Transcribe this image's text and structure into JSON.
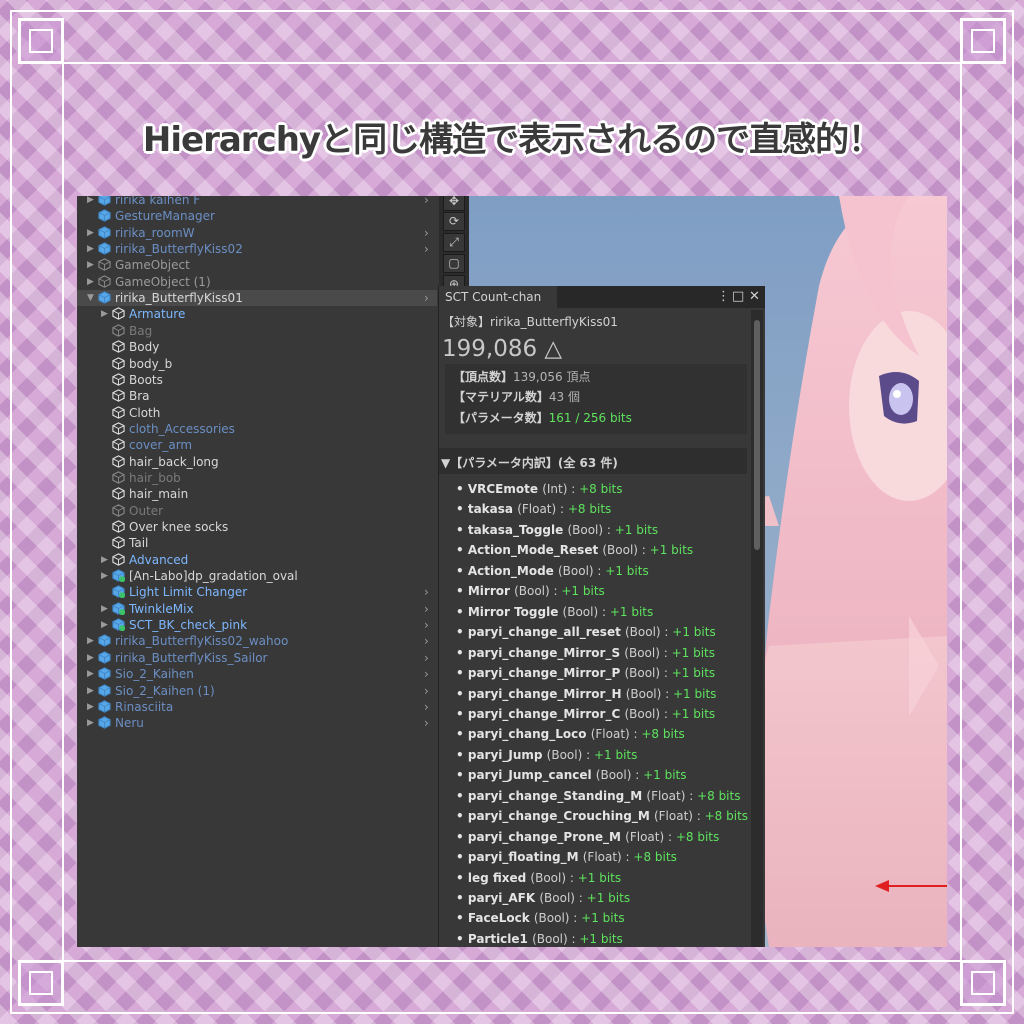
{
  "title": "Hierarchyと同じ構造で表示されるので直感的！",
  "colors": {
    "frame_purple": "#d7a9d7",
    "unity_bg": "#383838",
    "green_value": "#5ee35e",
    "blue_text": "#7db7ff"
  },
  "hierarchy": [
    {
      "label": "ririka kaihen F",
      "depth": 0,
      "arrow": "right",
      "icon": "prefab",
      "style": "dim",
      "chev": true
    },
    {
      "label": "GestureManager",
      "depth": 0,
      "arrow": "",
      "icon": "prefab",
      "style": "dim",
      "chev": false
    },
    {
      "label": "ririka_roomW",
      "depth": 0,
      "arrow": "right",
      "icon": "prefab",
      "style": "dim",
      "chev": true
    },
    {
      "label": "ririka_ButterflyKiss02",
      "depth": 0,
      "arrow": "right",
      "icon": "prefab",
      "style": "dim",
      "chev": true
    },
    {
      "label": "GameObject",
      "depth": 0,
      "arrow": "right",
      "icon": "cube",
      "style": "gray",
      "chev": false
    },
    {
      "label": "GameObject (1)",
      "depth": 0,
      "arrow": "right",
      "icon": "cube",
      "style": "gray",
      "chev": false
    },
    {
      "label": "ririka_ButterflyKiss01",
      "depth": 0,
      "arrow": "down",
      "icon": "prefab",
      "style": "white",
      "chev": true,
      "selected": true
    },
    {
      "label": "Armature",
      "depth": 1,
      "arrow": "right",
      "icon": "cube",
      "style": "blue",
      "chev": false
    },
    {
      "label": "Bag",
      "depth": 1,
      "arrow": "",
      "icon": "cube",
      "style": "dimgray",
      "chev": false
    },
    {
      "label": "Body",
      "depth": 1,
      "arrow": "",
      "icon": "cube",
      "style": "white",
      "chev": false
    },
    {
      "label": "body_b",
      "depth": 1,
      "arrow": "",
      "icon": "cube",
      "style": "white",
      "chev": false
    },
    {
      "label": "Boots",
      "depth": 1,
      "arrow": "",
      "icon": "cube",
      "style": "white",
      "chev": false
    },
    {
      "label": "Bra",
      "depth": 1,
      "arrow": "",
      "icon": "cube",
      "style": "white",
      "chev": false
    },
    {
      "label": "Cloth",
      "depth": 1,
      "arrow": "",
      "icon": "cube",
      "style": "white",
      "chev": false
    },
    {
      "label": "cloth_Accessories",
      "depth": 1,
      "arrow": "",
      "icon": "cube",
      "style": "dim",
      "chev": false
    },
    {
      "label": "cover_arm",
      "depth": 1,
      "arrow": "",
      "icon": "cube",
      "style": "dim",
      "chev": false
    },
    {
      "label": "hair_back_long",
      "depth": 1,
      "arrow": "",
      "icon": "cube",
      "style": "white",
      "chev": false
    },
    {
      "label": "hair_bob",
      "depth": 1,
      "arrow": "",
      "icon": "cube",
      "style": "dimgray",
      "chev": false
    },
    {
      "label": "hair_main",
      "depth": 1,
      "arrow": "",
      "icon": "cube",
      "style": "white",
      "chev": false
    },
    {
      "label": "Outer",
      "depth": 1,
      "arrow": "",
      "icon": "cube",
      "style": "dimgray",
      "chev": false
    },
    {
      "label": "Over knee socks",
      "depth": 1,
      "arrow": "",
      "icon": "cube",
      "style": "white",
      "chev": false
    },
    {
      "label": "Tail",
      "depth": 1,
      "arrow": "",
      "icon": "cube",
      "style": "white",
      "chev": false
    },
    {
      "label": "Advanced",
      "depth": 1,
      "arrow": "right",
      "icon": "cube",
      "style": "blue",
      "chev": false
    },
    {
      "label": "[An-Labo]dp_gradation_oval",
      "depth": 1,
      "arrow": "right",
      "icon": "prefab-green",
      "style": "white",
      "chev": false
    },
    {
      "label": "Light Limit Changer",
      "depth": 1,
      "arrow": "",
      "icon": "prefab-green",
      "style": "blue",
      "chev": true
    },
    {
      "label": "TwinkleMix",
      "depth": 1,
      "arrow": "right",
      "icon": "prefab-green",
      "style": "blue",
      "chev": true
    },
    {
      "label": "SCT_BK_check_pink",
      "depth": 1,
      "arrow": "right",
      "icon": "prefab-green",
      "style": "blue",
      "chev": true
    },
    {
      "label": "ririka_ButterflyKiss02_wahoo",
      "depth": 0,
      "arrow": "right",
      "icon": "prefab",
      "style": "dim",
      "chev": true
    },
    {
      "label": "ririka_ButterflyKiss_Sailor",
      "depth": 0,
      "arrow": "right",
      "icon": "prefab",
      "style": "dim",
      "chev": true
    },
    {
      "label": "Sio_2_Kaihen",
      "depth": 0,
      "arrow": "right",
      "icon": "prefab",
      "style": "dim",
      "chev": true
    },
    {
      "label": "Sio_2_Kaihen (1)",
      "depth": 0,
      "arrow": "right",
      "icon": "prefab",
      "style": "dim",
      "chev": true
    },
    {
      "label": "Rinasciita",
      "depth": 0,
      "arrow": "right",
      "icon": "prefab",
      "style": "dim",
      "chev": true
    },
    {
      "label": "Neru",
      "depth": 0,
      "arrow": "right",
      "icon": "prefab",
      "style": "dim",
      "chev": true
    }
  ],
  "panel": {
    "tab": "SCT Count-chan",
    "target_label": "【対象】",
    "target_value": "ririka_ButterflyKiss01",
    "polycount": "199,086 △",
    "vertices_label": "【頂点数】",
    "vertices_value": "139,056 頂点",
    "materials_label": "【マテリアル数】",
    "materials_value": "43 個",
    "params_label": "【パラメータ数】",
    "params_value": "161 / 256 bits",
    "breakdown_header": "▼【パラメータ内訳】(全 63 件)",
    "params": [
      {
        "name": "VRCEmote",
        "type": "(Int) : ",
        "bits": "+8 bits"
      },
      {
        "name": "takasa",
        "type": "(Float) : ",
        "bits": "+8 bits"
      },
      {
        "name": "takasa_Toggle",
        "type": "(Bool) : ",
        "bits": "+1 bits"
      },
      {
        "name": "Action_Mode_Reset",
        "type": "(Bool) : ",
        "bits": "+1 bits"
      },
      {
        "name": "Action_Mode",
        "type": "(Bool) : ",
        "bits": "+1 bits"
      },
      {
        "name": "Mirror",
        "type": "(Bool) : ",
        "bits": "+1 bits"
      },
      {
        "name": "Mirror Toggle",
        "type": "(Bool) : ",
        "bits": "+1 bits"
      },
      {
        "name": "paryi_change_all_reset",
        "type": "(Bool) : ",
        "bits": "+1 bits"
      },
      {
        "name": "paryi_change_Mirror_S",
        "type": "(Bool) : ",
        "bits": "+1 bits"
      },
      {
        "name": "paryi_change_Mirror_P",
        "type": "(Bool) : ",
        "bits": "+1 bits"
      },
      {
        "name": "paryi_change_Mirror_H",
        "type": "(Bool) : ",
        "bits": "+1 bits"
      },
      {
        "name": "paryi_change_Mirror_C",
        "type": "(Bool) : ",
        "bits": "+1 bits"
      },
      {
        "name": "paryi_chang_Loco",
        "type": "(Float) : ",
        "bits": "+8 bits"
      },
      {
        "name": "paryi_Jump",
        "type": "(Bool) : ",
        "bits": "+1 bits"
      },
      {
        "name": "paryi_Jump_cancel",
        "type": "(Bool) : ",
        "bits": "+1 bits"
      },
      {
        "name": "paryi_change_Standing_M",
        "type": "(Float) : ",
        "bits": "+8 bits"
      },
      {
        "name": "paryi_change_Crouching_M",
        "type": "(Float) : ",
        "bits": "+8 bits"
      },
      {
        "name": "paryi_change_Prone_M",
        "type": "(Float) : ",
        "bits": "+8 bits"
      },
      {
        "name": "paryi_floating_M",
        "type": "(Float) : ",
        "bits": "+8 bits"
      },
      {
        "name": "leg fixed",
        "type": "(Bool) : ",
        "bits": "+1 bits"
      },
      {
        "name": "paryi_AFK",
        "type": "(Bool) : ",
        "bits": "+1 bits"
      },
      {
        "name": "FaceLock",
        "type": "(Bool) : ",
        "bits": "+1 bits"
      },
      {
        "name": "Particle1",
        "type": "(Bool) : ",
        "bits": "+1 bits"
      }
    ]
  }
}
